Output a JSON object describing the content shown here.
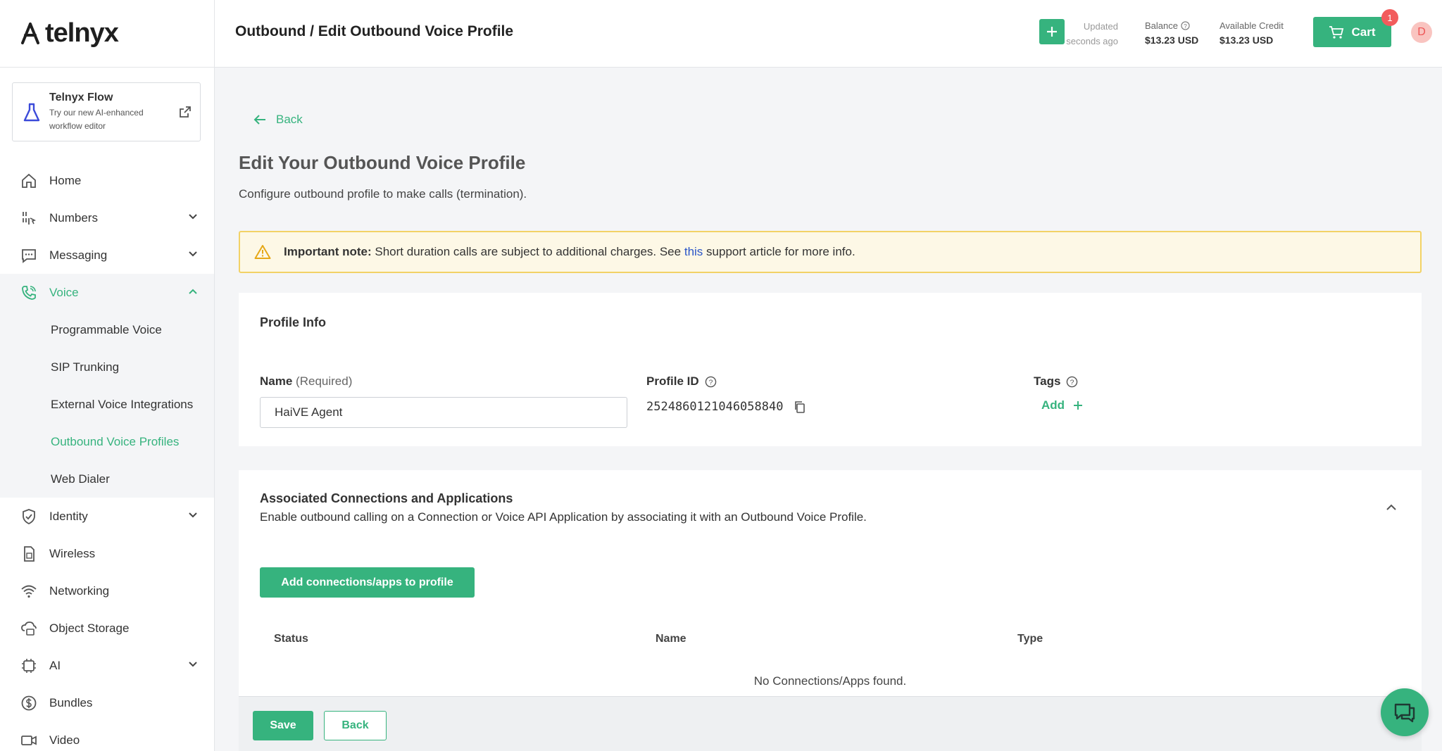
{
  "brand": {
    "logo_text": "telnyx",
    "accent": "#36b37e"
  },
  "flow_card": {
    "title": "Telnyx Flow",
    "subtitle": "Try our new AI-enhanced workflow editor"
  },
  "sidebar": {
    "items": [
      {
        "label": "Home",
        "icon": "home-icon"
      },
      {
        "label": "Numbers",
        "icon": "numbers-icon"
      },
      {
        "label": "Messaging",
        "icon": "messaging-icon"
      },
      {
        "label": "Voice",
        "icon": "voice-icon"
      },
      {
        "label": "Identity",
        "icon": "identity-icon"
      },
      {
        "label": "Wireless",
        "icon": "wireless-icon"
      },
      {
        "label": "Networking",
        "icon": "networking-icon"
      },
      {
        "label": "Object Storage",
        "icon": "storage-icon"
      },
      {
        "label": "AI",
        "icon": "ai-icon"
      },
      {
        "label": "Bundles",
        "icon": "bundles-icon"
      },
      {
        "label": "Video",
        "icon": "video-icon"
      }
    ],
    "voice_sub": [
      {
        "label": "Programmable Voice"
      },
      {
        "label": "SIP Trunking"
      },
      {
        "label": "External Voice Integrations"
      },
      {
        "label": "Outbound Voice Profiles"
      },
      {
        "label": "Web Dialer"
      }
    ]
  },
  "header": {
    "breadcrumb": "Outbound / Edit Outbound Voice Profile",
    "updated_label": "Updated",
    "updated_value": "a few seconds ago",
    "balance_label": "Balance",
    "balance_value": "$13.23 USD",
    "credit_label": "Available Credit",
    "credit_value": "$13.23 USD",
    "cart_label": "Cart",
    "cart_count": "1",
    "avatar_initial": "D"
  },
  "main": {
    "back_label": "Back",
    "title": "Edit Your Outbound Voice Profile",
    "subtitle": "Configure outbound profile to make calls (termination).",
    "warning": {
      "bold": "Important note:",
      "text_before": "Short duration calls are subject to additional charges. See",
      "link": "this",
      "text_after": "support article for more info."
    },
    "profile_info": {
      "title": "Profile Info",
      "name_label": "Name",
      "name_required": "(Required)",
      "name_value": "HaiVE Agent",
      "profile_id_label": "Profile ID",
      "profile_id_value": "2524860121046058840",
      "tags_label": "Tags",
      "tags_add": "Add"
    },
    "associated": {
      "title": "Associated Connections and Applications",
      "subtitle": "Enable outbound calling on a Connection or Voice API Application by associating it with an Outbound Voice Profile.",
      "add_button": "Add connections/apps to profile",
      "columns": [
        "Status",
        "Name",
        "Type"
      ],
      "empty": "No Connections/Apps found."
    },
    "footer": {
      "save": "Save",
      "back": "Back"
    }
  }
}
